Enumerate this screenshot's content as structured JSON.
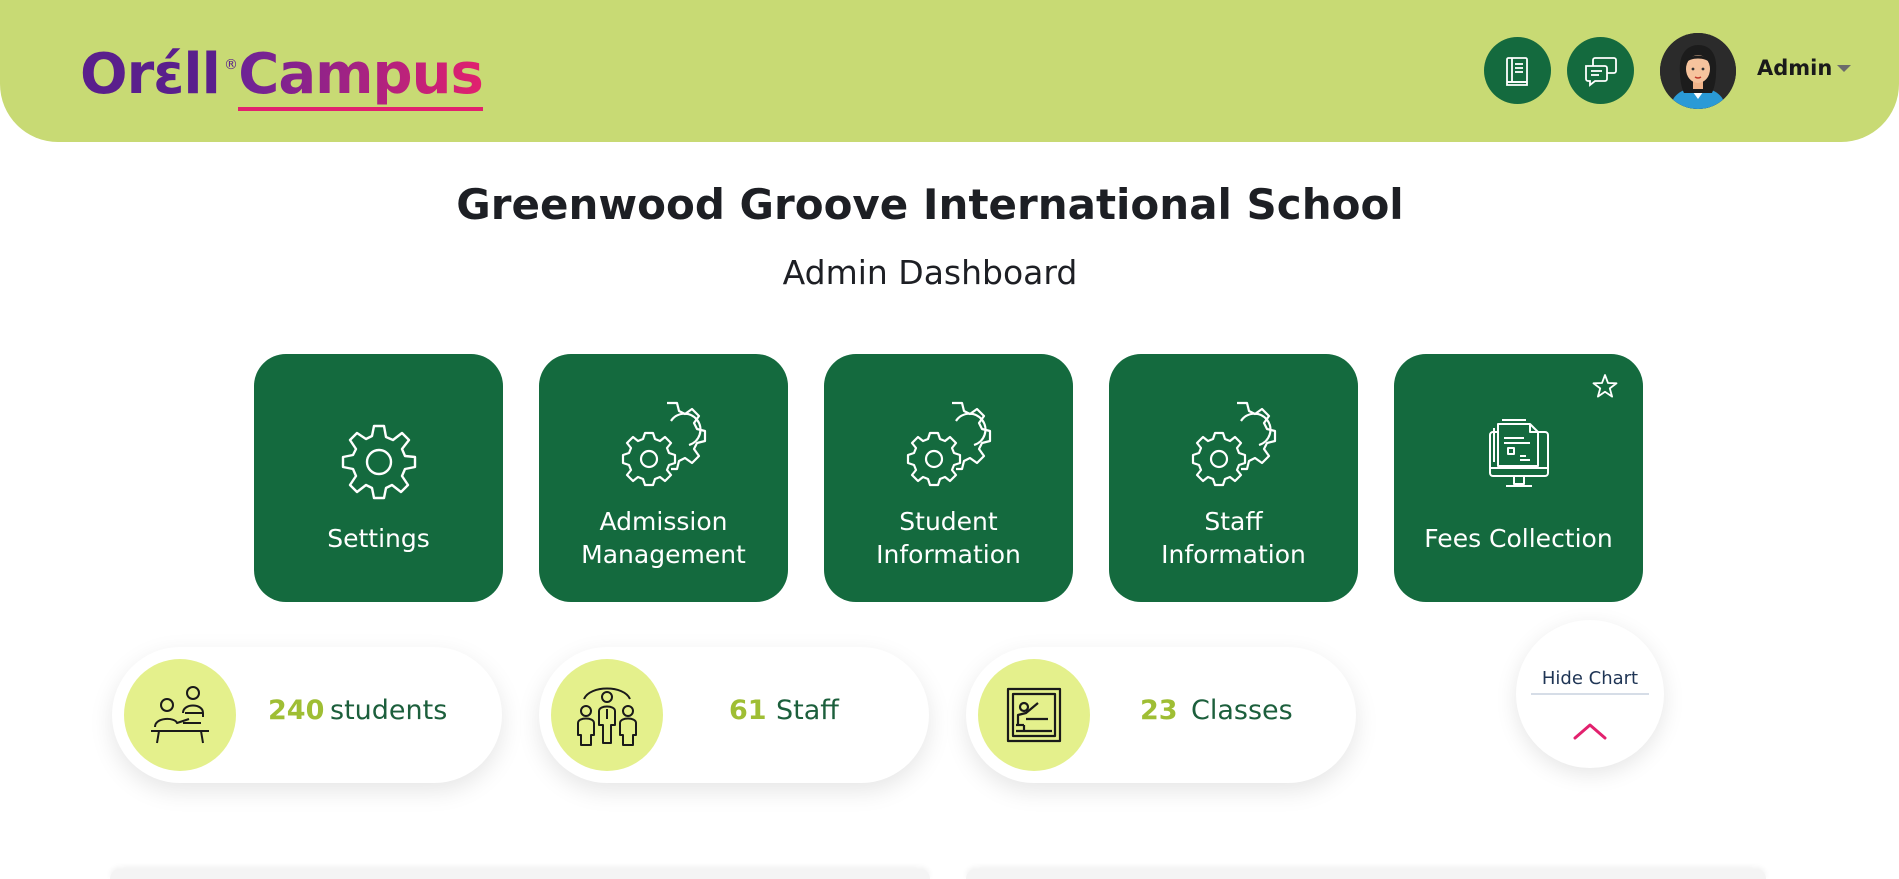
{
  "header": {
    "logo_part1": "Orell",
    "logo_part1_display": "Orέll",
    "logo_part2": "Campus",
    "logo_reg": "®",
    "user_name": "Admin",
    "icons": [
      "book-icon",
      "chat-icon"
    ]
  },
  "main": {
    "school_name": "Greenwood Groove International School",
    "dashboard_title": "Admin Dashboard"
  },
  "tiles": [
    {
      "label": "Settings",
      "icon": "gear-icon"
    },
    {
      "label": "Admission\nManagement",
      "icon": "gears-icon"
    },
    {
      "label": "Student\nInformation",
      "icon": "gears-icon"
    },
    {
      "label": "Staff\nInformation",
      "icon": "gears-icon"
    },
    {
      "label": "Fees Collection",
      "icon": "fees-monitor-icon",
      "favorite_icon": "star-icon"
    }
  ],
  "stats": [
    {
      "value": "240",
      "label": "students",
      "icon": "students-icon"
    },
    {
      "value": "61",
      "label": "Staff",
      "icon": "staff-icon"
    },
    {
      "value": "23",
      "label": "Classes",
      "icon": "classroom-icon"
    }
  ],
  "chart_toggle": {
    "label": "Hide Chart",
    "icon": "chevron-up-icon"
  },
  "colors": {
    "header_bg": "#c8da74",
    "tile_bg": "#146a3e",
    "stat_circle": "#e4f08c",
    "stat_number": "#9fbe34",
    "stat_label": "#1c5f3c",
    "logo_purple": "#5a1f8c",
    "logo_pink": "#e2216e"
  }
}
